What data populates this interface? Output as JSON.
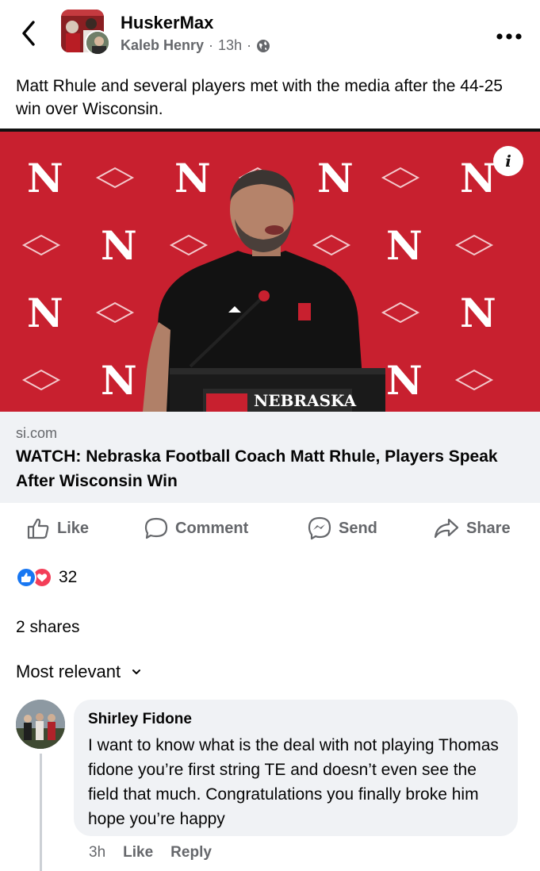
{
  "header": {
    "page_name": "HuskerMax",
    "author": "Kaleb Henry",
    "separator": "·",
    "time": "13h"
  },
  "post": {
    "text": "Matt Rhule and several players met with the media after the 44-25 win over Wisconsin."
  },
  "link_card": {
    "image_icon": "info-icon",
    "image_backdrop_letter": "N",
    "podium_text": "NEBRASKA",
    "domain": "si.com",
    "title": "WATCH: Nebraska Football Coach Matt Rhule, Players Speak After Wisconsin Win"
  },
  "actions": [
    {
      "label": "Like",
      "icon": "thumbs-up-icon"
    },
    {
      "label": "Comment",
      "icon": "comment-bubble-icon"
    },
    {
      "label": "Send",
      "icon": "messenger-icon"
    },
    {
      "label": "Share",
      "icon": "share-arrow-icon"
    }
  ],
  "reactions": {
    "count": "32",
    "types": [
      "like",
      "love"
    ]
  },
  "shares": "2 shares",
  "comments_sort": "Most relevant",
  "comment": {
    "author": "Shirley Fidone",
    "text": "I want to know what is the deal with not playing Thomas fidone you’re first string TE and doesn’t even see the field that much. Congratulations you finally broke him hope you’re happy",
    "time": "3h",
    "like_label": "Like",
    "reply_label": "Reply"
  },
  "colors": {
    "brand_red": "#c8202f",
    "like_blue": "#1877f2",
    "love_red": "#f33e58",
    "secondary_text": "#65676b"
  }
}
